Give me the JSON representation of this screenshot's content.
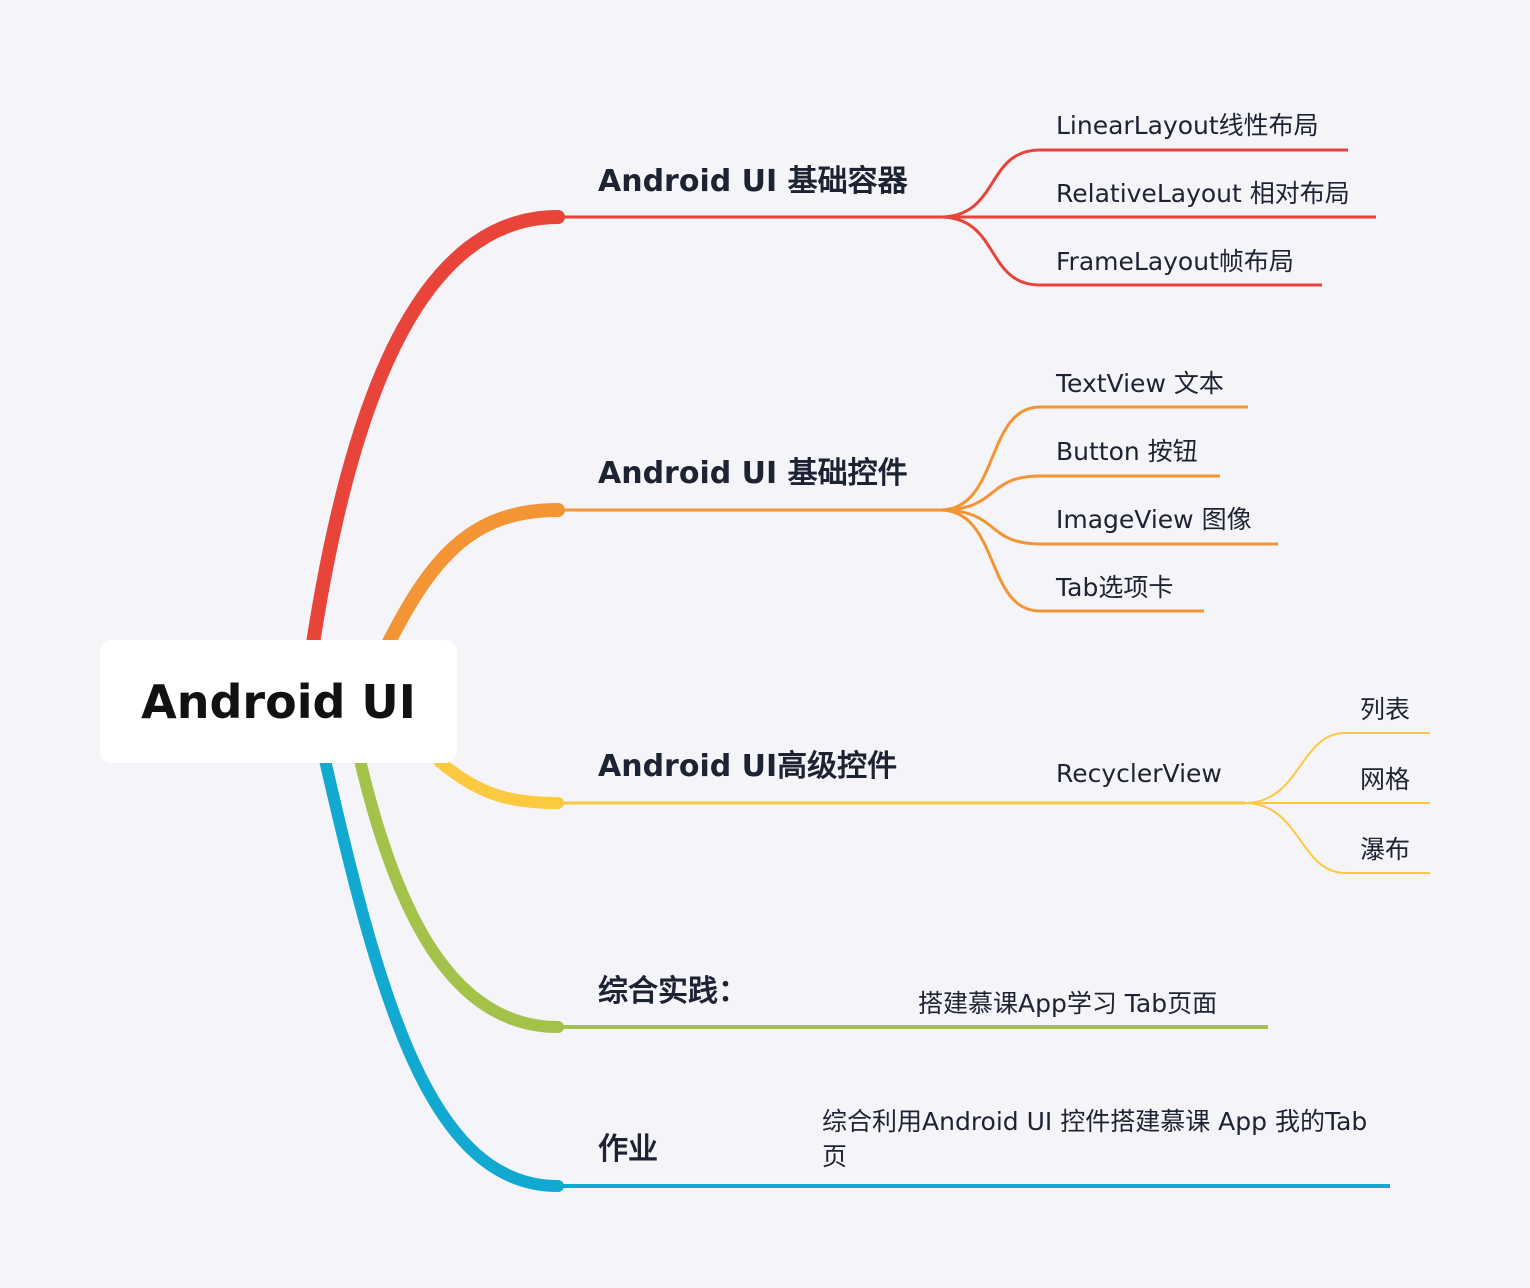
{
  "root": {
    "label": "Android UI"
  },
  "branches": [
    {
      "label": "Android UI 基础容器",
      "color": "#e8443a",
      "children": [
        "LinearLayout线性布局",
        "RelativeLayout 相对布局",
        "FrameLayout帧布局"
      ]
    },
    {
      "label": "Android UI 基础控件",
      "color": "#f39535",
      "children": [
        "TextView 文本",
        "Button 按钮",
        "ImageView 图像",
        "Tab选项卡"
      ]
    },
    {
      "label": "Android UI高级控件",
      "color": "#fcc93f",
      "children": [
        {
          "label": "RecyclerView",
          "children": [
            "列表",
            "网格",
            "瀑布"
          ]
        }
      ]
    },
    {
      "label": "综合实践：",
      "color": "#a3c24a",
      "children": [
        "搭建慕课App学习 Tab页面"
      ]
    },
    {
      "label": "作业",
      "color": "#11a9cf",
      "children": [
        "综合利用Android UI 控件搭建慕课 App 我的Tab页"
      ]
    }
  ]
}
